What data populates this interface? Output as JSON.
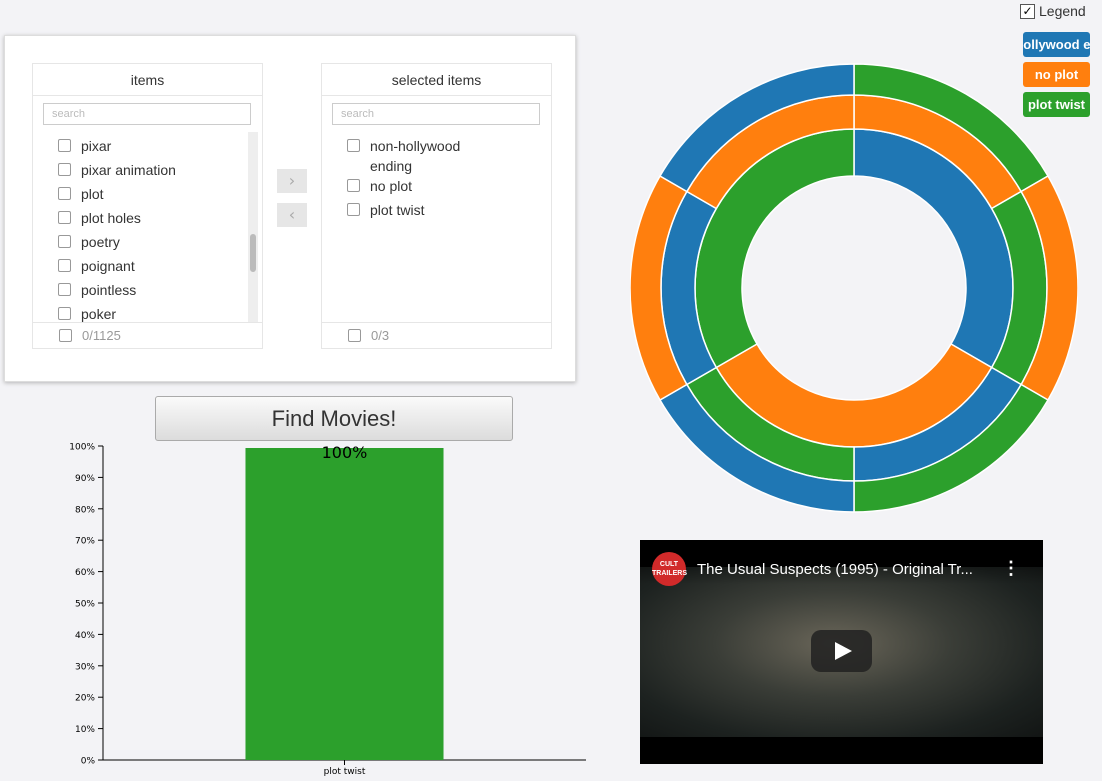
{
  "transfer": {
    "items_header": "items",
    "selected_header": "selected items",
    "search_placeholder": "search",
    "available_items": [
      {
        "label": "pixar"
      },
      {
        "label": "pixar animation"
      },
      {
        "label": "plot"
      },
      {
        "label": "plot holes"
      },
      {
        "label": "poetry"
      },
      {
        "label": "poignant"
      },
      {
        "label": "pointless"
      },
      {
        "label": "poker"
      }
    ],
    "selected_items": [
      {
        "label": "non-hollywood ending"
      },
      {
        "label": "no plot"
      },
      {
        "label": "plot twist"
      }
    ],
    "available_count": "0/1125",
    "selected_count": "0/3",
    "move_right_icon": "›",
    "move_left_icon": "‹"
  },
  "find_button": "Find Movies!",
  "legend": {
    "label": "Legend",
    "checked": true,
    "items": [
      {
        "label": "non-hollywood ending",
        "color": "#1f77b4"
      },
      {
        "label": "no plot",
        "color": "#ff7f0e"
      },
      {
        "label": "plot twist",
        "color": "#2ca02c"
      }
    ]
  },
  "video": {
    "title": "The Usual Suspects (1995) - Original Tr...",
    "channel": "CULT TRAILERS",
    "menu_icon": "⋮"
  },
  "chart_data": [
    {
      "type": "bar",
      "categories": [
        "plot twist"
      ],
      "values": [
        100
      ],
      "colors": [
        "#2ca02c"
      ],
      "data_labels": [
        "100%"
      ],
      "ylim": [
        0,
        100
      ],
      "yticks": [
        "0%",
        "10%",
        "20%",
        "30%",
        "40%",
        "50%",
        "60%",
        "70%",
        "80%",
        "90%",
        "100%"
      ]
    },
    {
      "type": "pie",
      "subtype": "multi-ring donut",
      "colors": {
        "non-hollywood ending": "#1f77b4",
        "no plot": "#ff7f0e",
        "plot twist": "#2ca02c"
      },
      "rings": [
        {
          "ring": "inner",
          "slices": [
            {
              "label": "non-hollywood ending",
              "value": 1
            },
            {
              "label": "no plot",
              "value": 1
            },
            {
              "label": "plot twist",
              "value": 1
            }
          ]
        },
        {
          "ring": "middle",
          "slices": [
            {
              "label": "no plot",
              "value": 1
            },
            {
              "label": "plot twist",
              "value": 1
            },
            {
              "label": "non-hollywood ending",
              "value": 1
            },
            {
              "label": "plot twist",
              "value": 1
            },
            {
              "label": "non-hollywood ending",
              "value": 1
            },
            {
              "label": "no plot",
              "value": 1
            }
          ]
        },
        {
          "ring": "outer",
          "slices": [
            {
              "label": "plot twist",
              "value": 1
            },
            {
              "label": "no plot",
              "value": 1
            },
            {
              "label": "plot twist",
              "value": 1
            },
            {
              "label": "non-hollywood ending",
              "value": 1
            },
            {
              "label": "no plot",
              "value": 1
            },
            {
              "label": "non-hollywood ending",
              "value": 1
            }
          ]
        }
      ]
    }
  ]
}
